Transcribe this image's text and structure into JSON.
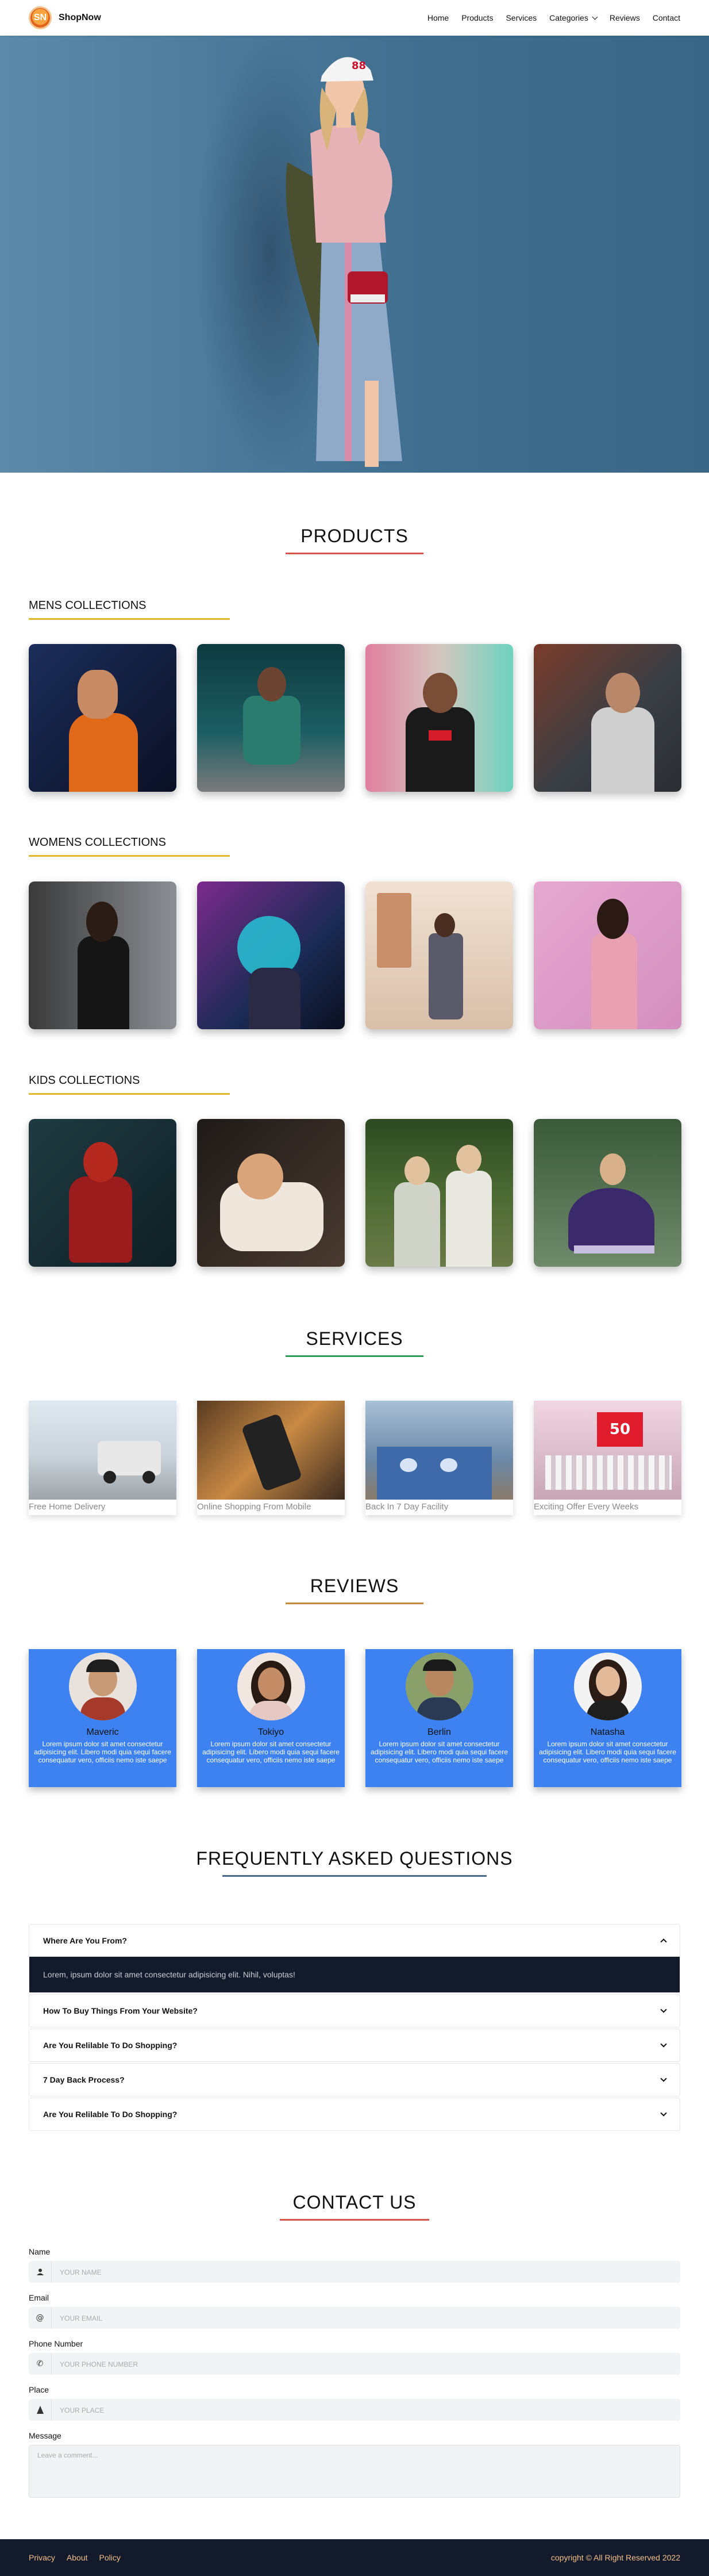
{
  "brand": {
    "logo_text": "SN",
    "name": "ShopNow"
  },
  "nav": {
    "items": [
      {
        "label": "Home"
      },
      {
        "label": "Products"
      },
      {
        "label": "Services"
      },
      {
        "label": "Categories",
        "dropdown": true
      },
      {
        "label": "Reviews"
      },
      {
        "label": "Contact"
      }
    ]
  },
  "hero": {
    "image": "woman-fashion-photo"
  },
  "products": {
    "title": "PRODUCTS",
    "underline_color": "#d9534f",
    "collections": [
      {
        "heading": "MENS COLLECTIONS",
        "images": [
          "man-orange-shirt-photo",
          "man-green-tracksuit-photo",
          "man-black-sweatshirt-photo",
          "man-grey-sweater-photo"
        ]
      },
      {
        "heading": "WOMENS COLLECTIONS",
        "images": [
          "woman-black-tshirt-photo",
          "woman-neon-light-photo",
          "woman-store-photo",
          "woman-pink-sweater-photo"
        ]
      },
      {
        "heading": "KIDS COLLECTIONS",
        "images": [
          "girl-red-dress-photo",
          "girl-resting-photo",
          "two-boys-photo",
          "girl-purple-dress-photo"
        ]
      }
    ]
  },
  "services": {
    "title": "SERVICES",
    "underline_color": "#2e9e5a",
    "items": [
      {
        "label": "Free Home Delivery"
      },
      {
        "label": "Online Shopping From Mobile"
      },
      {
        "label": "Back In 7 Day Facility"
      },
      {
        "label": "Exciting Offer Every Weeks"
      }
    ]
  },
  "reviews": {
    "title": "REVIEWS",
    "underline_color": "#c48a3a",
    "items": [
      {
        "name": "Maveric",
        "text": "Lorem ipsum dolor sit amet consectetur adipisicing elit. Libero modi quia sequi facere consequatur vero, officiis nemo iste saepe maxime."
      },
      {
        "name": "Tokiyo",
        "text": "Lorem ipsum dolor sit amet consectetur adipisicing elit. Libero modi quia sequi facere consequatur vero, officiis nemo iste saepe maxime."
      },
      {
        "name": "Berlin",
        "text": "Lorem ipsum dolor sit amet consectetur adipisicing elit. Libero modi quia sequi facere consequatur vero, officiis nemo iste saepe maxime."
      },
      {
        "name": "Natasha",
        "text": "Lorem ipsum dolor sit amet consectetur adipisicing elit. Libero modi quia sequi facere consequatur vero, officiis nemo iste saepe maxime."
      }
    ]
  },
  "faq": {
    "title": "FREQUENTLY ASKED QUESTIONS",
    "underline_color": "#4a6a8a",
    "items": [
      {
        "question": "Where Are You From?",
        "answer": "Lorem, ipsum dolor sit amet consectetur adipisicing elit. Nihil, voluptas!",
        "open": true
      },
      {
        "question": "How To Buy Things From Your Website?"
      },
      {
        "question": "Are You Relilable To Do Shopping?"
      },
      {
        "question": "7 Day Back Process?"
      },
      {
        "question": "Are You Relilable To Do Shopping?"
      }
    ]
  },
  "contact": {
    "title": "CONTACT US",
    "underline_color": "#d9534f",
    "fields": {
      "name": {
        "label": "Name",
        "placeholder": "YOUR NAME",
        "icon": "user-icon"
      },
      "email": {
        "label": "Email",
        "placeholder": "YOUR EMAIL",
        "icon": "at-icon"
      },
      "phone": {
        "label": "Phone Number",
        "placeholder": "YOUR PHONE NUMBER",
        "icon": "phone-icon"
      },
      "place": {
        "label": "Place",
        "placeholder": "YOUR PLACE",
        "icon": "location-icon"
      },
      "message": {
        "label": "Message",
        "placeholder": "Leave a comment..."
      }
    }
  },
  "footer": {
    "links": [
      {
        "label": "Privacy"
      },
      {
        "label": "About"
      },
      {
        "label": "Policy"
      }
    ],
    "copyright": "copyright © All Right Reserved 2022"
  },
  "colors": {
    "accent_yellow": "#e2b82a",
    "review_card": "#3d82f0",
    "footer_bg": "#131a2b",
    "footer_text": "#f3c08a"
  }
}
